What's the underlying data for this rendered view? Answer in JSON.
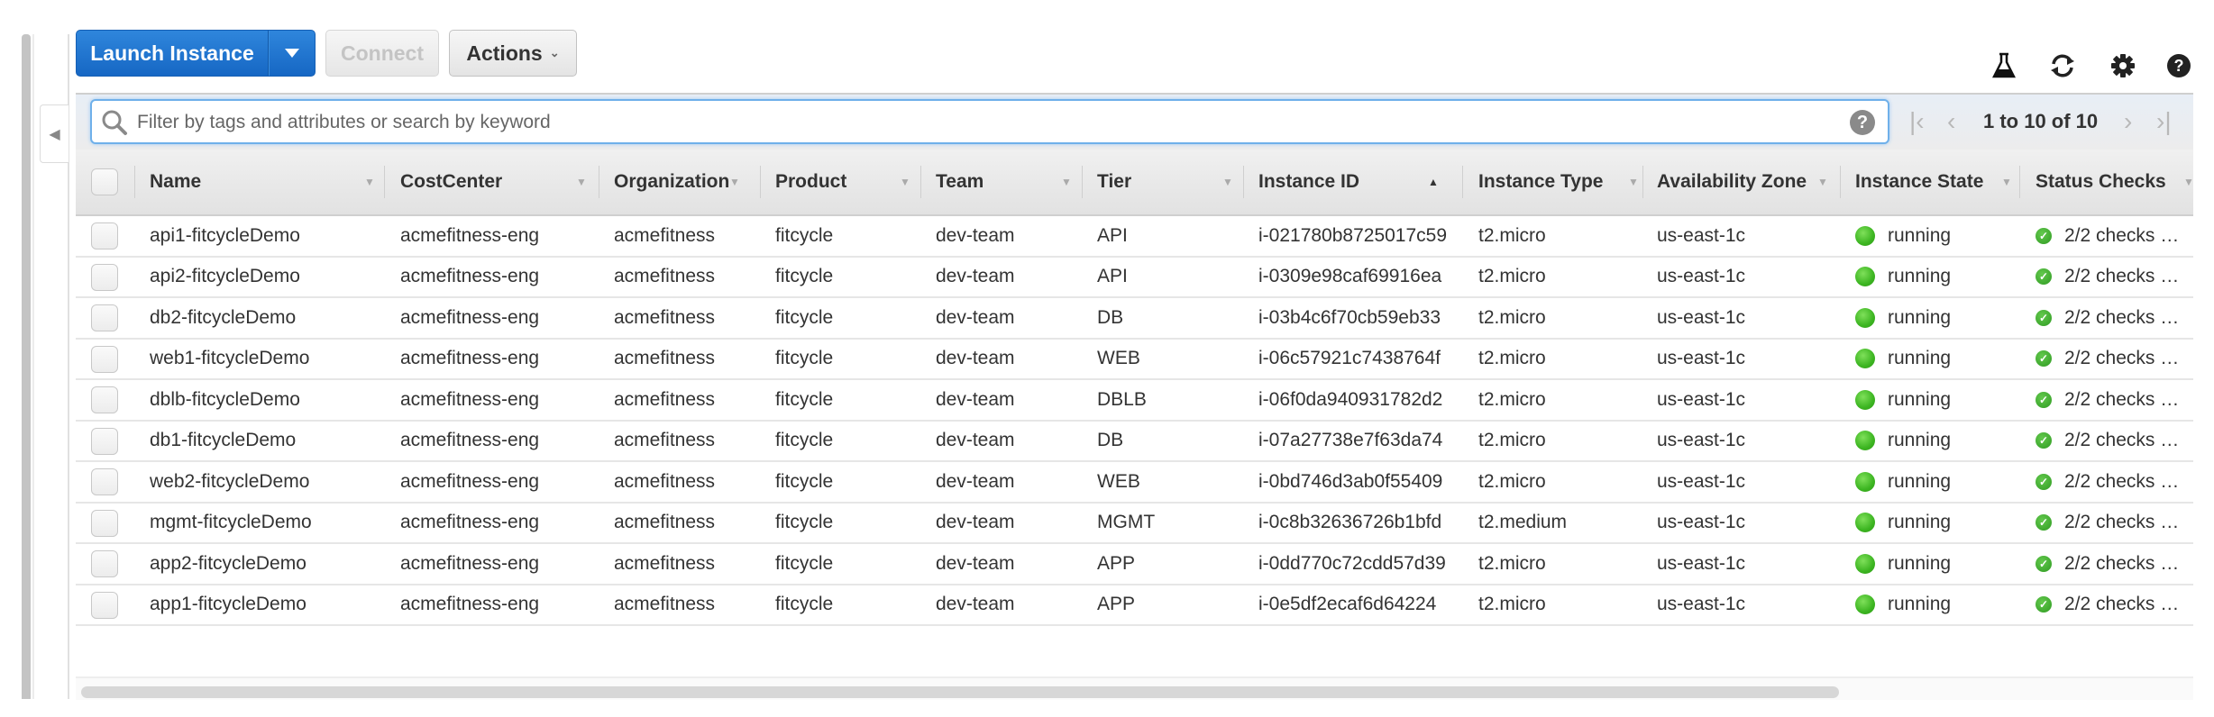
{
  "toolbar": {
    "launch_label": "Launch Instance",
    "connect_label": "Connect",
    "actions_label": "Actions",
    "icons": [
      "flask-icon",
      "refresh-icon",
      "gear-icon",
      "help-icon"
    ]
  },
  "search": {
    "placeholder": "Filter by tags and attributes or search by keyword",
    "value": ""
  },
  "pagination": {
    "text": "1 to 10 of 10"
  },
  "table": {
    "columns": [
      {
        "label": "Name",
        "sort": "none"
      },
      {
        "label": "CostCenter",
        "sort": "none"
      },
      {
        "label": "Organization",
        "sort": "none"
      },
      {
        "label": "Product",
        "sort": "none"
      },
      {
        "label": "Team",
        "sort": "none"
      },
      {
        "label": "Tier",
        "sort": "none"
      },
      {
        "label": "Instance ID",
        "sort": "ascending"
      },
      {
        "label": "Instance Type",
        "sort": "none"
      },
      {
        "label": "Availability Zone",
        "sort": "none"
      },
      {
        "label": "Instance State",
        "sort": "none"
      },
      {
        "label": "Status Checks",
        "sort": "none"
      }
    ],
    "rows": [
      {
        "name": "api1-fitcycleDemo",
        "cost_center": "acmefitness-eng",
        "organization": "acmefitness",
        "product": "fitcycle",
        "team": "dev-team",
        "tier": "API",
        "instance_id": "i-021780b8725017c59",
        "instance_type": "t2.micro",
        "az": "us-east-1c",
        "state": "running",
        "status_checks": "2/2 checks …"
      },
      {
        "name": "api2-fitcycleDemo",
        "cost_center": "acmefitness-eng",
        "organization": "acmefitness",
        "product": "fitcycle",
        "team": "dev-team",
        "tier": "API",
        "instance_id": "i-0309e98caf69916ea",
        "instance_type": "t2.micro",
        "az": "us-east-1c",
        "state": "running",
        "status_checks": "2/2 checks …"
      },
      {
        "name": "db2-fitcycleDemo",
        "cost_center": "acmefitness-eng",
        "organization": "acmefitness",
        "product": "fitcycle",
        "team": "dev-team",
        "tier": "DB",
        "instance_id": "i-03b4c6f70cb59eb33",
        "instance_type": "t2.micro",
        "az": "us-east-1c",
        "state": "running",
        "status_checks": "2/2 checks …"
      },
      {
        "name": "web1-fitcycleDemo",
        "cost_center": "acmefitness-eng",
        "organization": "acmefitness",
        "product": "fitcycle",
        "team": "dev-team",
        "tier": "WEB",
        "instance_id": "i-06c57921c7438764f",
        "instance_type": "t2.micro",
        "az": "us-east-1c",
        "state": "running",
        "status_checks": "2/2 checks …"
      },
      {
        "name": "dblb-fitcycleDemo",
        "cost_center": "acmefitness-eng",
        "organization": "acmefitness",
        "product": "fitcycle",
        "team": "dev-team",
        "tier": "DBLB",
        "instance_id": "i-06f0da940931782d2",
        "instance_type": "t2.micro",
        "az": "us-east-1c",
        "state": "running",
        "status_checks": "2/2 checks …"
      },
      {
        "name": "db1-fitcycleDemo",
        "cost_center": "acmefitness-eng",
        "organization": "acmefitness",
        "product": "fitcycle",
        "team": "dev-team",
        "tier": "DB",
        "instance_id": "i-07a27738e7f63da74",
        "instance_type": "t2.micro",
        "az": "us-east-1c",
        "state": "running",
        "status_checks": "2/2 checks …"
      },
      {
        "name": "web2-fitcycleDemo",
        "cost_center": "acmefitness-eng",
        "organization": "acmefitness",
        "product": "fitcycle",
        "team": "dev-team",
        "tier": "WEB",
        "instance_id": "i-0bd746d3ab0f55409",
        "instance_type": "t2.micro",
        "az": "us-east-1c",
        "state": "running",
        "status_checks": "2/2 checks …"
      },
      {
        "name": "mgmt-fitcycleDemo",
        "cost_center": "acmefitness-eng",
        "organization": "acmefitness",
        "product": "fitcycle",
        "team": "dev-team",
        "tier": "MGMT",
        "instance_id": "i-0c8b32636726b1bfd",
        "instance_type": "t2.medium",
        "az": "us-east-1c",
        "state": "running",
        "status_checks": "2/2 checks …"
      },
      {
        "name": "app2-fitcycleDemo",
        "cost_center": "acmefitness-eng",
        "organization": "acmefitness",
        "product": "fitcycle",
        "team": "dev-team",
        "tier": "APP",
        "instance_id": "i-0dd770c72cdd57d39",
        "instance_type": "t2.micro",
        "az": "us-east-1c",
        "state": "running",
        "status_checks": "2/2 checks …"
      },
      {
        "name": "app1-fitcycleDemo",
        "cost_center": "acmefitness-eng",
        "organization": "acmefitness",
        "product": "fitcycle",
        "team": "dev-team",
        "tier": "APP",
        "instance_id": "i-0e5df2ecaf6d64224",
        "instance_type": "t2.micro",
        "az": "us-east-1c",
        "state": "running",
        "status_checks": "2/2 checks …"
      }
    ]
  },
  "colors": {
    "primary": "#1f73d0",
    "running": "#3cb521",
    "check_ok": "#2f9a22"
  }
}
